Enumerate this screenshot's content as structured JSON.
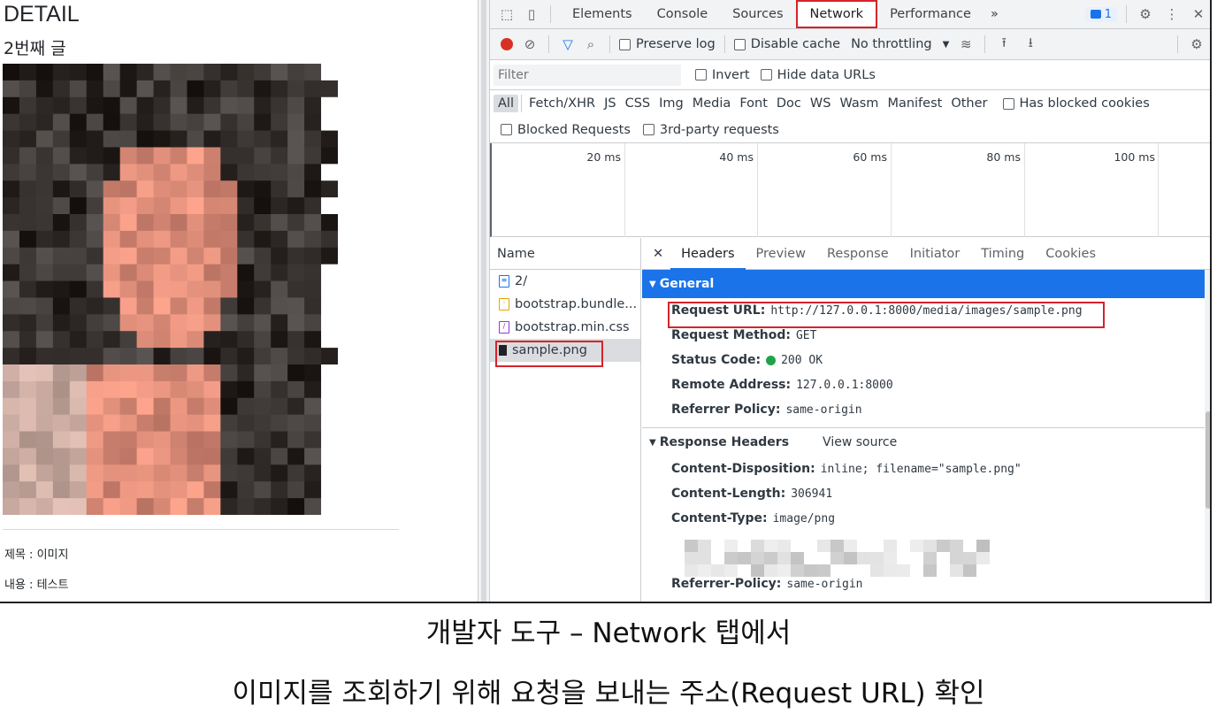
{
  "webpage": {
    "heading": "DETAIL",
    "subtitle": "2번째 글",
    "field_title": "제목 : 이미지",
    "field_content": "내용 : 테스트"
  },
  "devtools": {
    "tabs": [
      "Elements",
      "Console",
      "Sources",
      "Network",
      "Performance"
    ],
    "active_tab": "Network",
    "more_tabs_glyph": "»",
    "issues_badge": "1",
    "toolbar": {
      "preserve_log": "Preserve log",
      "disable_cache": "Disable cache",
      "throttling": "No throttling"
    },
    "filter": {
      "placeholder": "Filter",
      "invert": "Invert",
      "hide_data_urls": "Hide data URLs"
    },
    "types": [
      "All",
      "Fetch/XHR",
      "JS",
      "CSS",
      "Img",
      "Media",
      "Font",
      "Doc",
      "WS",
      "Wasm",
      "Manifest",
      "Other"
    ],
    "has_blocked_cookies": "Has blocked cookies",
    "blocked_requests": "Blocked Requests",
    "third_party": "3rd-party requests",
    "timeline_ticks": [
      "20 ms",
      "40 ms",
      "60 ms",
      "80 ms",
      "100 ms"
    ],
    "name_header": "Name",
    "requests": [
      {
        "name": "2/",
        "icon": "document-icon",
        "color": "#1a73e8"
      },
      {
        "name": "bootstrap.bundle...",
        "icon": "script-icon",
        "color": "#e8a300"
      },
      {
        "name": "bootstrap.min.css",
        "icon": "stylesheet-icon",
        "color": "#9334e6"
      },
      {
        "name": "sample.png",
        "icon": "image-icon",
        "color": "#202124"
      }
    ],
    "detail_tabs": [
      "Headers",
      "Preview",
      "Response",
      "Initiator",
      "Timing",
      "Cookies"
    ],
    "general": {
      "title": "General",
      "request_url_k": "Request URL:",
      "request_url_v": "http://127.0.0.1:8000/media/images/sample.png",
      "request_method_k": "Request Method:",
      "request_method_v": "GET",
      "status_code_k": "Status Code:",
      "status_code_v": "200 OK",
      "remote_address_k": "Remote Address:",
      "remote_address_v": "127.0.0.1:8000",
      "referrer_policy_k": "Referrer Policy:",
      "referrer_policy_v": "same-origin"
    },
    "response_headers": {
      "title": "Response Headers",
      "view_source": "View source",
      "content_disposition_k": "Content-Disposition:",
      "content_disposition_v": "inline; filename=\"sample.png\"",
      "content_length_k": "Content-Length:",
      "content_length_v": "306941",
      "content_type_k": "Content-Type:",
      "content_type_v": "image/png",
      "referrer_policy_k": "Referrer-Policy:",
      "referrer_policy_v": "same-origin"
    }
  },
  "captions": {
    "line1": "개발자 도구 – Network 탭에서",
    "line2": "이미지를 조회하기 위해 요청을 보내는 주소(Request URL) 확인"
  },
  "colors": {
    "highlight_red": "#d6232a",
    "accent_blue": "#1a73e8",
    "status_green": "#1ea446"
  }
}
